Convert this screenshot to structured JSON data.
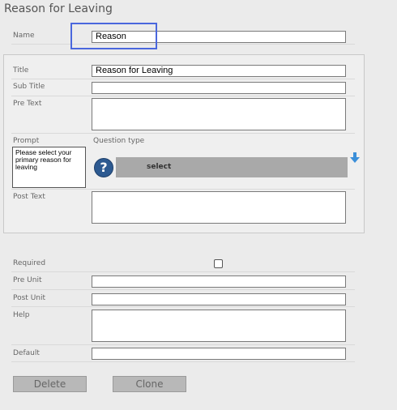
{
  "page": {
    "title": "Reason for Leaving"
  },
  "labels": {
    "name": "Name",
    "title": "Title",
    "subtitle": "Sub Title",
    "pretext": "Pre Text",
    "prompt": "Prompt",
    "question_type": "Question type",
    "posttext": "Post Text",
    "required": "Required",
    "pre_unit": "Pre Unit",
    "post_unit": "Post Unit",
    "help": "Help",
    "default": "Default"
  },
  "fields": {
    "name": "Reason",
    "title": "Reason for Leaving",
    "subtitle": "",
    "pretext": "",
    "prompt": "Please select your primary reason for leaving",
    "question_type": "select",
    "posttext": "",
    "required": false,
    "pre_unit": "",
    "post_unit": "",
    "help": "",
    "default": ""
  },
  "buttons": {
    "delete": "Delete",
    "clone": "Clone"
  },
  "icons": {
    "help": "help-question-icon",
    "move": "arrow-down-icon"
  },
  "colors": {
    "focus": "#4a67dd",
    "help_icon": "#2d5a91",
    "arrow": "#3b8fd9"
  }
}
